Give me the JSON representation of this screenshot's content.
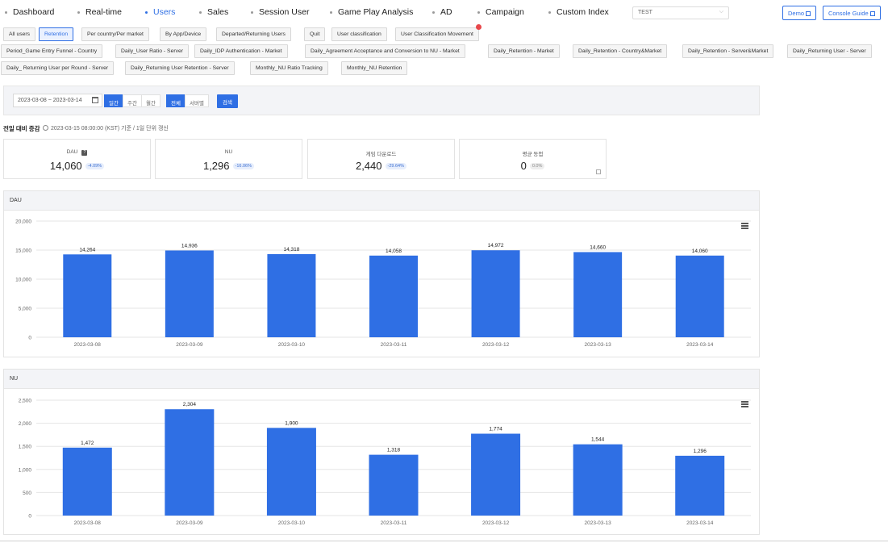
{
  "nav": {
    "items": [
      "Dashboard",
      "Real-time",
      "Users",
      "Sales",
      "Session User",
      "Game Play Analysis",
      "AD",
      "Campaign",
      "Custom Index"
    ],
    "active": "Users",
    "project": "TEST",
    "demo_label": "Demo",
    "guide_label": "Console Guide"
  },
  "tabs": {
    "row1": [
      "All users",
      "Retention",
      "Per country/Per market",
      "By App/Device",
      "Departed/Returning Users",
      "Quit",
      "User classification",
      "User Classification Movement"
    ],
    "row2": [
      "Period_Game Entry Funnel - Country",
      "Daily_User Ratio - Server",
      "Daily_IDP Authentication - Market",
      "Daily_Agreement Acceptance and Conversion to NU - Market",
      "Daily_Retention - Market",
      "Daily_Retention - Country&Market",
      "Daily_Retention - Server&Market",
      "Daily_Returning User - Server"
    ],
    "row3": [
      "Daily_ Returning User per Round - Server",
      "Daily_Returning User Retention - Server",
      "Monthly_NU Ratio Tracking",
      "Monthly_NU Retention"
    ],
    "active": "Retention"
  },
  "filter": {
    "date_range": "2023-03-08 ~ 2023-03-14",
    "period_buttons": [
      "일간",
      "주간",
      "월간"
    ],
    "scope_buttons": [
      "전체",
      "서버별"
    ],
    "search_label": "검색"
  },
  "summary": {
    "title": "전일 대비 증감",
    "note": "2023-03-15 08:00:00 (KST) 기준 / 1일 단위 갱신"
  },
  "kpis": [
    {
      "label": "DAU",
      "value": "14,060",
      "pct": "-4.09%",
      "help": "?"
    },
    {
      "label": "NU",
      "value": "1,296",
      "pct": "-16.06%"
    },
    {
      "label": "게임 다운로드",
      "value": "2,440",
      "pct": "-29.64%"
    },
    {
      "label": "평균 동접",
      "value": "0",
      "pct": "0.0%"
    }
  ],
  "colors": {
    "accent": "#2f6fe4",
    "bar": "#2f6fe4"
  },
  "chart_data": [
    {
      "type": "bar",
      "title": "DAU",
      "categories": [
        "2023-03-08",
        "2023-03-09",
        "2023-03-10",
        "2023-03-11",
        "2023-03-12",
        "2023-03-13",
        "2023-03-14"
      ],
      "values": [
        14264,
        14936,
        14318,
        14058,
        14972,
        14660,
        14060
      ],
      "labels": [
        "14,264",
        "14,936",
        "14,318",
        "14,058",
        "14,972",
        "14,660",
        "14,060"
      ],
      "ylim": [
        0,
        20000
      ],
      "yticks": [
        0,
        5000,
        10000,
        15000,
        20000
      ],
      "ytick_labels": [
        "0",
        "5,000",
        "10,000",
        "15,000",
        "20,000"
      ],
      "grid": true
    },
    {
      "type": "bar",
      "title": "NU",
      "categories": [
        "2023-03-08",
        "2023-03-09",
        "2023-03-10",
        "2023-03-11",
        "2023-03-12",
        "2023-03-13",
        "2023-03-14"
      ],
      "values": [
        1472,
        2304,
        1900,
        1318,
        1774,
        1544,
        1296
      ],
      "labels": [
        "1,472",
        "2,304",
        "1,900",
        "1,318",
        "1,774",
        "1,544",
        "1,296"
      ],
      "ylim": [
        0,
        2500
      ],
      "yticks": [
        0,
        500,
        1000,
        1500,
        2000,
        2500
      ],
      "ytick_labels": [
        "0",
        "500",
        "1,000",
        "1,500",
        "2,000",
        "2,500"
      ],
      "grid": true
    }
  ]
}
